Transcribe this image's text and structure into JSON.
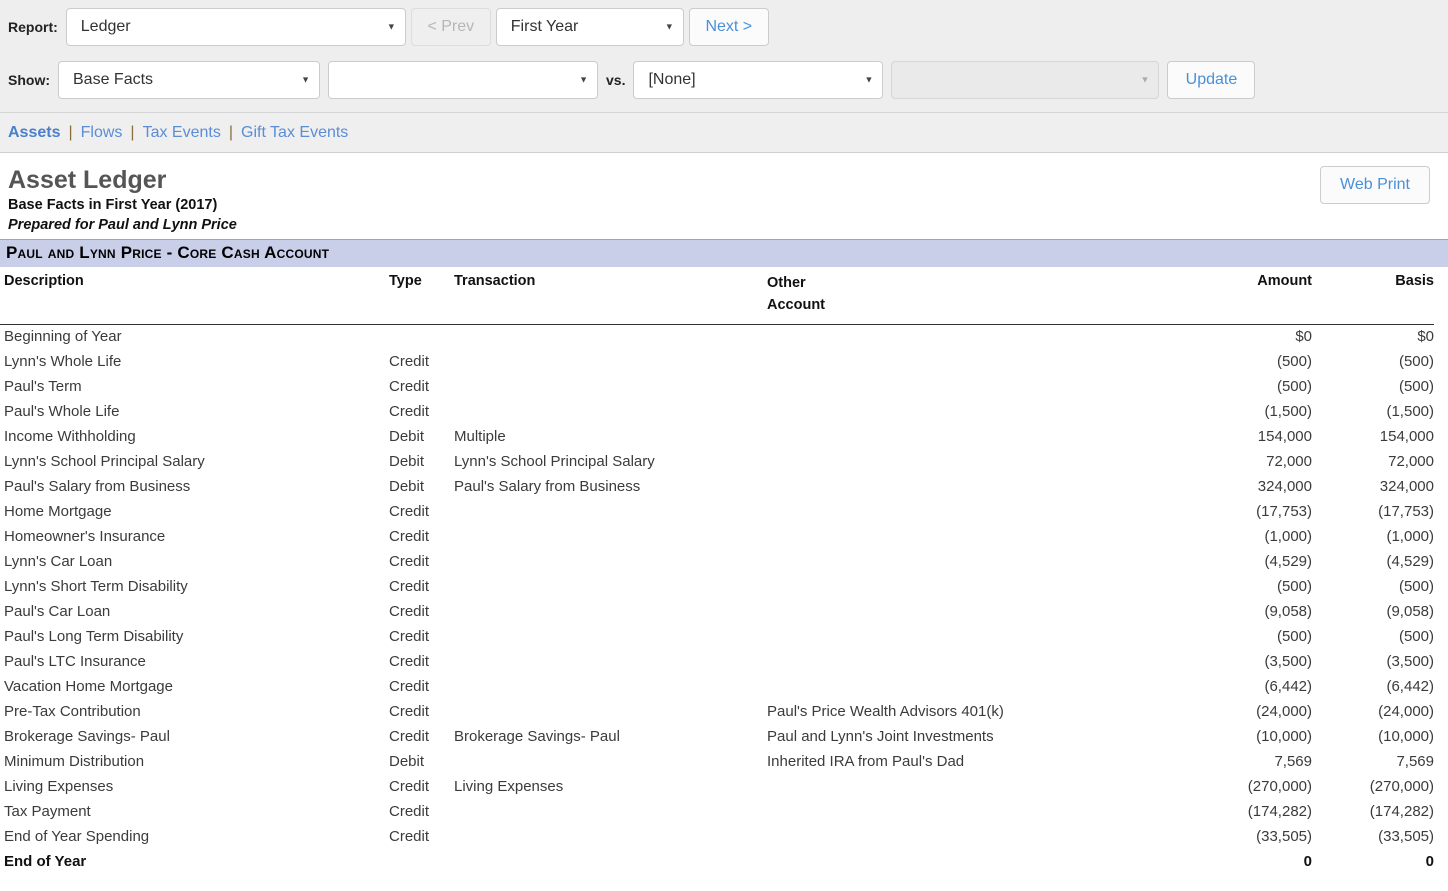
{
  "toolbar": {
    "report_label": "Report:",
    "report_value": "Ledger",
    "prev_label": "< Prev",
    "year_value": "First Year",
    "next_label": "Next >",
    "show_label": "Show:",
    "show_value": "Base Facts",
    "show_value2": "",
    "vs_label": "vs.",
    "compare_value": "[None]",
    "compare_value2": "",
    "update_label": "Update"
  },
  "nav": {
    "items": [
      {
        "label": "Assets",
        "active": true
      },
      {
        "label": "Flows",
        "active": false
      },
      {
        "label": "Tax Events",
        "active": false
      },
      {
        "label": "Gift Tax Events",
        "active": false
      }
    ],
    "separator": "|"
  },
  "report": {
    "title": "Asset Ledger",
    "subtitle": "Base Facts in First Year (2017)",
    "prepared_for": "Prepared for Paul and Lynn Price",
    "web_print_label": "Web Print",
    "section_header": "Paul and Lynn Price - Core Cash Account"
  },
  "table": {
    "headers": {
      "description": "Description",
      "type": "Type",
      "transaction": "Transaction",
      "other_account_line1": "Other",
      "other_account_line2": "Account",
      "amount": "Amount",
      "basis": "Basis"
    },
    "rows": [
      {
        "description": "Beginning of Year",
        "type": "",
        "transaction": "",
        "other": "",
        "amount": "$0",
        "basis": "$0",
        "total": false
      },
      {
        "description": "Lynn's Whole Life",
        "type": "Credit",
        "transaction": "",
        "other": "",
        "amount": "(500)",
        "basis": "(500)",
        "total": false
      },
      {
        "description": "Paul's Term",
        "type": "Credit",
        "transaction": "",
        "other": "",
        "amount": "(500)",
        "basis": "(500)",
        "total": false
      },
      {
        "description": "Paul's Whole Life",
        "type": "Credit",
        "transaction": "",
        "other": "",
        "amount": "(1,500)",
        "basis": "(1,500)",
        "total": false
      },
      {
        "description": "Income Withholding",
        "type": "Debit",
        "transaction": "Multiple",
        "other": "",
        "amount": "154,000",
        "basis": "154,000",
        "total": false
      },
      {
        "description": "Lynn's School Principal Salary",
        "type": "Debit",
        "transaction": "Lynn's School Principal Salary",
        "other": "",
        "amount": "72,000",
        "basis": "72,000",
        "total": false
      },
      {
        "description": "Paul's Salary from Business",
        "type": "Debit",
        "transaction": "Paul's Salary from Business",
        "other": "",
        "amount": "324,000",
        "basis": "324,000",
        "total": false
      },
      {
        "description": "Home Mortgage",
        "type": "Credit",
        "transaction": "",
        "other": "",
        "amount": "(17,753)",
        "basis": "(17,753)",
        "total": false
      },
      {
        "description": "Homeowner's Insurance",
        "type": "Credit",
        "transaction": "",
        "other": "",
        "amount": "(1,000)",
        "basis": "(1,000)",
        "total": false
      },
      {
        "description": "Lynn's Car Loan",
        "type": "Credit",
        "transaction": "",
        "other": "",
        "amount": "(4,529)",
        "basis": "(4,529)",
        "total": false
      },
      {
        "description": "Lynn's Short Term Disability",
        "type": "Credit",
        "transaction": "",
        "other": "",
        "amount": "(500)",
        "basis": "(500)",
        "total": false
      },
      {
        "description": "Paul's Car Loan",
        "type": "Credit",
        "transaction": "",
        "other": "",
        "amount": "(9,058)",
        "basis": "(9,058)",
        "total": false
      },
      {
        "description": "Paul's Long Term Disability",
        "type": "Credit",
        "transaction": "",
        "other": "",
        "amount": "(500)",
        "basis": "(500)",
        "total": false
      },
      {
        "description": "Paul's LTC Insurance",
        "type": "Credit",
        "transaction": "",
        "other": "",
        "amount": "(3,500)",
        "basis": "(3,500)",
        "total": false
      },
      {
        "description": "Vacation Home Mortgage",
        "type": "Credit",
        "transaction": "",
        "other": "",
        "amount": "(6,442)",
        "basis": "(6,442)",
        "total": false
      },
      {
        "description": "Pre-Tax Contribution",
        "type": "Credit",
        "transaction": "",
        "other": "Paul's Price Wealth Advisors 401(k)",
        "amount": "(24,000)",
        "basis": "(24,000)",
        "total": false
      },
      {
        "description": "Brokerage Savings- Paul",
        "type": "Credit",
        "transaction": "Brokerage Savings- Paul",
        "other": "Paul and Lynn's Joint Investments",
        "amount": "(10,000)",
        "basis": "(10,000)",
        "total": false
      },
      {
        "description": "Minimum Distribution",
        "type": "Debit",
        "transaction": "",
        "other": "Inherited IRA from Paul's Dad",
        "amount": "7,569",
        "basis": "7,569",
        "total": false
      },
      {
        "description": "Living Expenses",
        "type": "Credit",
        "transaction": "Living Expenses",
        "other": "",
        "amount": "(270,000)",
        "basis": "(270,000)",
        "total": false
      },
      {
        "description": "Tax Payment",
        "type": "Credit",
        "transaction": "",
        "other": "",
        "amount": "(174,282)",
        "basis": "(174,282)",
        "total": false
      },
      {
        "description": "End of Year Spending",
        "type": "Credit",
        "transaction": "",
        "other": "",
        "amount": "(33,505)",
        "basis": "(33,505)",
        "total": false
      },
      {
        "description": "End of Year",
        "type": "",
        "transaction": "",
        "other": "",
        "amount": "0",
        "basis": "0",
        "total": true
      }
    ]
  },
  "colors": {
    "link": "#5b8dd6",
    "section_band": "#c9cfe8",
    "toolbar_bg": "#eeeeee"
  }
}
